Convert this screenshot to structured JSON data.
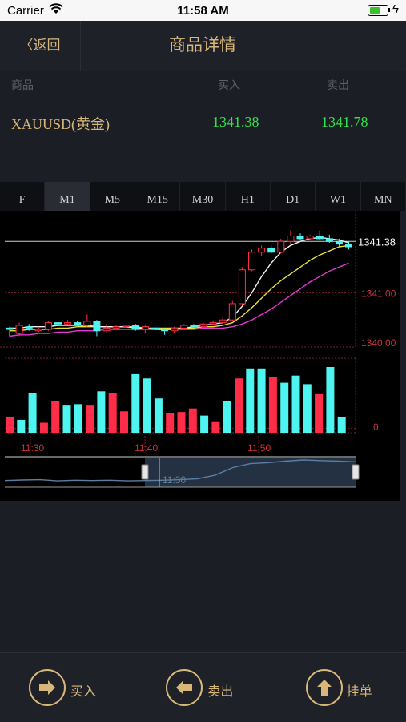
{
  "status_bar": {
    "carrier": "Carrier",
    "time": "11:58 AM"
  },
  "nav": {
    "back_label": "〈返回",
    "title": "商品详情"
  },
  "quote": {
    "headers": {
      "product": "商品",
      "buy": "买入",
      "sell": "卖出"
    },
    "symbol": "XAUUSD(黄金)",
    "buy_price": "1341.38",
    "sell_price": "1341.78"
  },
  "period_tabs": [
    "F",
    "M1",
    "M5",
    "M15",
    "M30",
    "H1",
    "D1",
    "W1",
    "MN"
  ],
  "active_tab": "M1",
  "colors": {
    "accent": "#d8b77b",
    "price_up": "#2ee34c",
    "candle_up": "#4ef5f0",
    "candle_down": "#ff2d48"
  },
  "chart_data": {
    "type": "candlestick",
    "price_labels": {
      "current": "1341.38",
      "upper": "1341.00",
      "lower": "1340.00"
    },
    "volume_axis_label": "0",
    "time_labels": [
      "11:30",
      "11:40",
      "11:50"
    ],
    "navigator_label": "11:30",
    "candles": [
      {
        "o": 1340.74,
        "c": 1340.73,
        "h": 1340.75,
        "l": 1340.68
      },
      {
        "o": 1340.7,
        "c": 1340.76,
        "h": 1340.78,
        "l": 1340.68
      },
      {
        "o": 1340.75,
        "c": 1340.74,
        "h": 1340.77,
        "l": 1340.72
      },
      {
        "o": 1340.72,
        "c": 1340.73,
        "h": 1340.75,
        "l": 1340.71
      },
      {
        "o": 1340.73,
        "c": 1340.78,
        "h": 1340.79,
        "l": 1340.72
      },
      {
        "o": 1340.78,
        "c": 1340.77,
        "h": 1340.8,
        "l": 1340.76
      },
      {
        "o": 1340.77,
        "c": 1340.78,
        "h": 1340.8,
        "l": 1340.76
      },
      {
        "o": 1340.78,
        "c": 1340.76,
        "h": 1340.79,
        "l": 1340.75
      },
      {
        "o": 1340.76,
        "c": 1340.79,
        "h": 1340.84,
        "l": 1340.75
      },
      {
        "o": 1340.79,
        "c": 1340.72,
        "h": 1340.8,
        "l": 1340.68
      },
      {
        "o": 1340.72,
        "c": 1340.74,
        "h": 1340.77,
        "l": 1340.71
      },
      {
        "o": 1340.74,
        "c": 1340.75,
        "h": 1340.76,
        "l": 1340.73
      },
      {
        "o": 1340.76,
        "c": 1340.76,
        "h": 1340.76,
        "l": 1340.75
      },
      {
        "o": 1340.76,
        "c": 1340.73,
        "h": 1340.77,
        "l": 1340.72
      },
      {
        "o": 1340.73,
        "c": 1340.75,
        "h": 1340.76,
        "l": 1340.7
      },
      {
        "o": 1340.74,
        "c": 1340.73,
        "h": 1340.75,
        "l": 1340.7
      },
      {
        "o": 1340.73,
        "c": 1340.72,
        "h": 1340.74,
        "l": 1340.69
      },
      {
        "o": 1340.72,
        "c": 1340.74,
        "h": 1340.75,
        "l": 1340.7
      },
      {
        "o": 1340.74,
        "c": 1340.76,
        "h": 1340.77,
        "l": 1340.73
      },
      {
        "o": 1340.76,
        "c": 1340.75,
        "h": 1340.77,
        "l": 1340.74
      },
      {
        "o": 1340.75,
        "c": 1340.77,
        "h": 1340.78,
        "l": 1340.74
      },
      {
        "o": 1340.77,
        "c": 1340.78,
        "h": 1340.79,
        "l": 1340.76
      },
      {
        "o": 1340.78,
        "c": 1340.8,
        "h": 1340.82,
        "l": 1340.77
      },
      {
        "o": 1340.8,
        "c": 1340.92,
        "h": 1340.94,
        "l": 1340.79
      },
      {
        "o": 1340.92,
        "c": 1341.17,
        "h": 1341.19,
        "l": 1340.91
      },
      {
        "o": 1341.17,
        "c": 1341.3,
        "h": 1341.32,
        "l": 1341.16
      },
      {
        "o": 1341.3,
        "c": 1341.33,
        "h": 1341.35,
        "l": 1341.27
      },
      {
        "o": 1341.33,
        "c": 1341.3,
        "h": 1341.35,
        "l": 1341.29
      },
      {
        "o": 1341.3,
        "c": 1341.38,
        "h": 1341.4,
        "l": 1341.29
      },
      {
        "o": 1341.38,
        "c": 1341.42,
        "h": 1341.46,
        "l": 1341.36
      },
      {
        "o": 1341.42,
        "c": 1341.4,
        "h": 1341.44,
        "l": 1341.39
      },
      {
        "o": 1341.4,
        "c": 1341.42,
        "h": 1341.43,
        "l": 1341.39
      },
      {
        "o": 1341.42,
        "c": 1341.4,
        "h": 1341.46,
        "l": 1341.39
      },
      {
        "o": 1341.4,
        "c": 1341.38,
        "h": 1341.43,
        "l": 1341.37
      },
      {
        "o": 1341.38,
        "c": 1341.36,
        "h": 1341.4,
        "l": 1341.34
      },
      {
        "o": 1341.36,
        "c": 1341.34,
        "h": 1341.38,
        "l": 1341.32
      }
    ],
    "volumes": [
      {
        "v": 22,
        "up": false
      },
      {
        "v": 18,
        "up": true
      },
      {
        "v": 55,
        "up": true
      },
      {
        "v": 14,
        "up": false
      },
      {
        "v": 44,
        "up": false
      },
      {
        "v": 38,
        "up": true
      },
      {
        "v": 40,
        "up": true
      },
      {
        "v": 38,
        "up": false
      },
      {
        "v": 58,
        "up": true
      },
      {
        "v": 56,
        "up": false
      },
      {
        "v": 30,
        "up": false
      },
      {
        "v": 82,
        "up": true
      },
      {
        "v": 76,
        "up": true
      },
      {
        "v": 48,
        "up": true
      },
      {
        "v": 28,
        "up": false
      },
      {
        "v": 29,
        "up": false
      },
      {
        "v": 34,
        "up": false
      },
      {
        "v": 24,
        "up": true
      },
      {
        "v": 16,
        "up": false
      },
      {
        "v": 44,
        "up": true
      },
      {
        "v": 76,
        "up": false
      },
      {
        "v": 90,
        "up": true
      },
      {
        "v": 90,
        "up": true
      },
      {
        "v": 78,
        "up": false
      },
      {
        "v": 70,
        "up": true
      },
      {
        "v": 80,
        "up": true
      },
      {
        "v": 68,
        "up": true
      },
      {
        "v": 54,
        "up": false
      },
      {
        "v": 92,
        "up": true
      },
      {
        "v": 22,
        "up": true
      }
    ],
    "ma_white": [
      1340.74,
      1340.74,
      1340.75,
      1340.75,
      1340.75,
      1340.76,
      1340.76,
      1340.76,
      1340.76,
      1340.75,
      1340.75,
      1340.75,
      1340.75,
      1340.74,
      1340.74,
      1340.73,
      1340.73,
      1340.73,
      1340.74,
      1340.75,
      1340.76,
      1340.77,
      1340.78,
      1340.82,
      1340.9,
      1341.0,
      1341.12,
      1341.22,
      1341.3,
      1341.35,
      1341.38,
      1341.4,
      1341.41,
      1341.4,
      1341.39,
      1341.37
    ],
    "ma_yellow": [
      1340.72,
      1340.72,
      1340.73,
      1340.73,
      1340.73,
      1340.74,
      1340.74,
      1340.75,
      1340.75,
      1340.75,
      1340.75,
      1340.75,
      1340.75,
      1340.75,
      1340.74,
      1340.74,
      1340.74,
      1340.74,
      1340.74,
      1340.74,
      1340.75,
      1340.75,
      1340.76,
      1340.78,
      1340.83,
      1340.89,
      1340.96,
      1341.03,
      1341.09,
      1341.14,
      1341.19,
      1341.24,
      1341.28,
      1341.31,
      1341.34,
      1341.35
    ],
    "ma_magenta": [
      1340.68,
      1340.69,
      1340.69,
      1340.7,
      1340.7,
      1340.71,
      1340.71,
      1340.72,
      1340.72,
      1340.72,
      1340.73,
      1340.73,
      1340.73,
      1340.73,
      1340.73,
      1340.73,
      1340.73,
      1340.73,
      1340.73,
      1340.73,
      1340.74,
      1340.74,
      1340.74,
      1340.75,
      1340.77,
      1340.8,
      1340.84,
      1340.88,
      1340.93,
      1340.98,
      1341.03,
      1341.08,
      1341.12,
      1341.16,
      1341.19,
      1341.22
    ],
    "navigator_line": [
      1340.74,
      1340.76,
      1340.77,
      1340.73,
      1340.75,
      1340.74,
      1340.75,
      1340.73,
      1340.74,
      1340.75,
      1340.77,
      1340.8,
      1340.92,
      1341.17,
      1341.3,
      1341.33,
      1341.38,
      1341.42,
      1341.4,
      1341.38,
      1341.36
    ]
  },
  "bottom_actions": {
    "buy_label": "买入",
    "sell_label": "卖出",
    "order_label": "挂单"
  }
}
